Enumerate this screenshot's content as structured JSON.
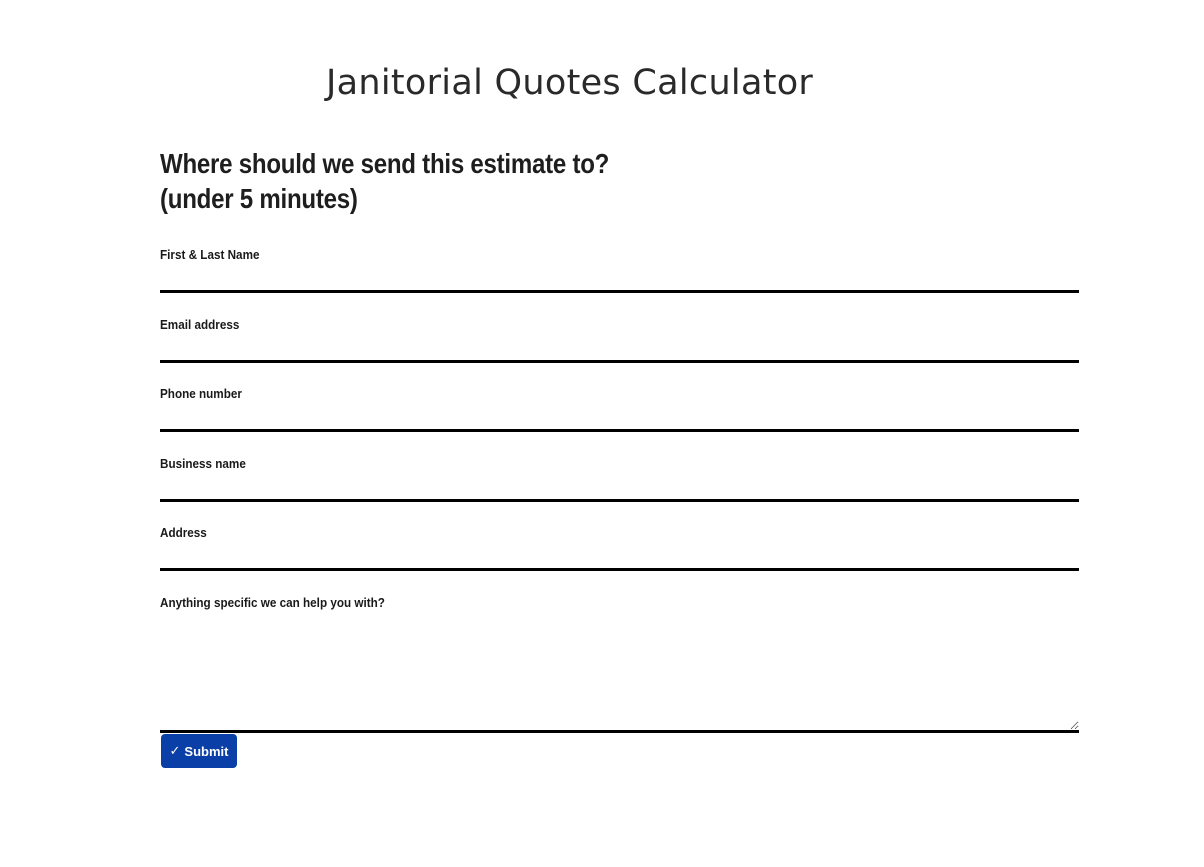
{
  "app": {
    "title": "Janitorial Quotes Calculator"
  },
  "form": {
    "heading_line1": "Where should we send this estimate to?",
    "heading_line2": "(under 5 minutes)",
    "fields": {
      "name": {
        "label": "First & Last Name",
        "value": "",
        "placeholder": ""
      },
      "email": {
        "label": "Email address",
        "value": "",
        "placeholder": ""
      },
      "phone": {
        "label": "Phone number",
        "value": "",
        "placeholder": ""
      },
      "business": {
        "label": "Business name",
        "value": "",
        "placeholder": ""
      },
      "address": {
        "label": "Address",
        "value": "",
        "placeholder": ""
      },
      "notes": {
        "label": "Anything specific we can help you with?",
        "value": "",
        "placeholder": ""
      }
    },
    "submit": {
      "icon": "✓",
      "label": "Submit",
      "color": "#0a3fa8"
    }
  }
}
